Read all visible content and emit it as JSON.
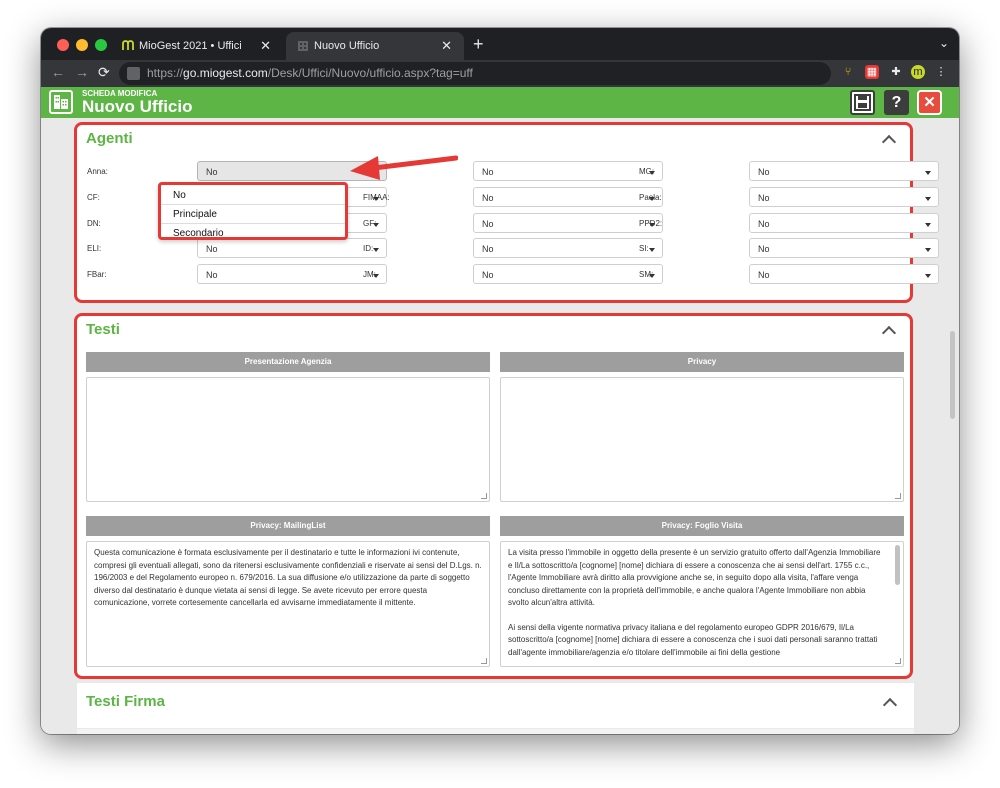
{
  "browser": {
    "tabs": [
      {
        "title": "MioGest 2021 • Uffici",
        "close": "✕"
      },
      {
        "title": "Nuovo Ufficio",
        "close": "✕"
      }
    ],
    "new_tab": "+",
    "url_scheme": "https://",
    "url_host": "go.miogest.com",
    "url_path": "/Desk/Uffici/Nuovo/ufficio.aspx?tag=uff"
  },
  "header": {
    "subtitle": "SCHEDA MODIFICA",
    "title": "Nuovo Ufficio",
    "help_label": "?",
    "close_label": "✕"
  },
  "agenti": {
    "title": "Agenti",
    "fields": [
      {
        "label": "Anna:",
        "value": "No"
      },
      {
        "label": "",
        "value": "No"
      },
      {
        "label": "MG:",
        "value": "No"
      },
      {
        "label": "CF:",
        "value": ""
      },
      {
        "label": "FIMAA:",
        "value": "No"
      },
      {
        "label": "Paola:",
        "value": "No"
      },
      {
        "label": "DN:",
        "value": ""
      },
      {
        "label": "GF:",
        "value": "No"
      },
      {
        "label": "PPD2:",
        "value": "No"
      },
      {
        "label": "ELI:",
        "value": "No"
      },
      {
        "label": "ID:",
        "value": "No"
      },
      {
        "label": "SI:",
        "value": "No"
      },
      {
        "label": "FBar:",
        "value": "No"
      },
      {
        "label": "JM:",
        "value": "No"
      },
      {
        "label": "SM:",
        "value": "No"
      }
    ],
    "dropdown_options": [
      "No",
      "Principale",
      "Secondario"
    ]
  },
  "testi": {
    "title": "Testi",
    "presentazione_header": "Presentazione Agenzia",
    "privacy_header": "Privacy",
    "mailinglist_header": "Privacy: MailingList",
    "foglio_header": "Privacy: Foglio Visita",
    "mailinglist_text": "Questa comunicazione è formata esclusivamente per il destinatario e tutte le informazioni ivi contenute, compresi gli eventuali allegati, sono da ritenersi esclusivamente confidenziali e riservate ai sensi del D.Lgs. n. 196/2003 e del Regolamento europeo n. 679/2016. La sua diffusione e/o utilizzazione da parte di soggetto diverso dal destinatario è dunque vietata ai sensi di legge. Se avete ricevuto per errore questa comunicazione, vorrete cortesemente cancellarla ed avvisarne immediatamente il mittente.",
    "foglio_text_1": "La visita presso l'immobile in oggetto della presente è un servizio gratuito offerto dall'Agenzia Immobiliare e Il/La sottoscritto/a [cognome] [nome] dichiara di essere a conoscenza che ai sensi dell'art. 1755 c.c., l'Agente Immobiliare avrà diritto alla provvigione anche se, in seguito dopo alla visita, l'affare venga concluso direttamente con la proprietà dell'immobile, e anche qualora l'Agente Immobiliare non abbia svolto alcun'altra attività.",
    "foglio_text_2": "Ai sensi della vigente normativa privacy italiana e del regolamento europeo GDPR 2016/679, Il/La sottoscritto/a [cognome] [nome] dichiara di essere a conoscenza che i suoi dati personali saranno trattati dall'agente immobiliare/agenzia e/o titolare dell'immobile ai fini della gestione"
  },
  "firma": {
    "title": "Testi Firma"
  },
  "colors": {
    "brand_green": "#5cb544",
    "highlight_red": "#e53935"
  }
}
